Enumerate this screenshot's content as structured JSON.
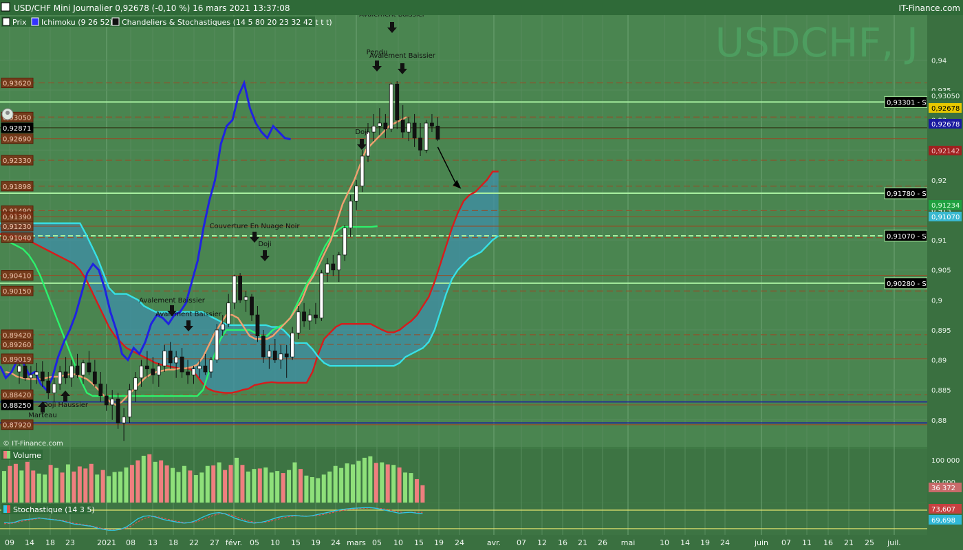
{
  "header": {
    "title": "USD/CHF Mini Journalier 0,92678 (-0,10 %) 16 mars 2021 13:37:08",
    "brand": "IT-Finance.com"
  },
  "legend": [
    {
      "label": "Prix",
      "color": "#ffffff"
    },
    {
      "label": "Ichimoku (9 26 52)",
      "color": "#3333ff"
    },
    {
      "label": "Chandeliers & Stochastiques (14 5 80 20 23 32 42 t t t)",
      "color": "#111111"
    }
  ],
  "watermark": "USDCHF, J",
  "copyright": "© IT-Finance.com",
  "colors": {
    "background": "#3f7a45",
    "grid": "#5d9163",
    "chikou": "#1f23e0",
    "tenkan": "#f0a070",
    "kijun": "#2cf26c",
    "spanA": "#d81b1b",
    "spanB": "#37e0e6",
    "cloud": "#3f8fa8",
    "support": "#a8f0a0",
    "resistance_dash": "#a0401a",
    "hline_solid": "#9a4a24",
    "blue_line": "#1a1aa0",
    "vol_up": "#8ee07a",
    "vol_down": "#ef7f7f",
    "stoch_k": "#30c8e8",
    "stoch_d": "#e05050",
    "stoch_band": "#e8e870"
  },
  "chart_data": [
    {
      "type": "line",
      "name": "price",
      "ylim": [
        0.8755,
        0.9475
      ],
      "y_ticks": [
        0.88,
        0.885,
        0.89,
        0.895,
        0.9,
        0.905,
        0.91,
        0.915,
        0.92,
        0.925,
        0.93,
        0.935,
        0.94
      ],
      "y_tick_labels": [
        "0,88",
        "0,885",
        "0,89",
        "0,895",
        "0,9",
        "0,905",
        "0,91",
        "0,915",
        "0,92",
        "0,925",
        "0,93",
        "0,935",
        "0,94"
      ],
      "x_labels": [
        "09",
        "14",
        "18",
        "23",
        "2021",
        "08",
        "13",
        "18",
        "22",
        "27",
        "févr.",
        "05",
        "10",
        "15",
        "19",
        "24",
        "mars",
        "05",
        "10",
        "15",
        "19",
        "24",
        "avr.",
        "07",
        "12",
        "16",
        "21",
        "26",
        "mai",
        "10",
        "14",
        "19",
        "24",
        "juin",
        "07",
        "11",
        "16",
        "21",
        "25",
        "juil."
      ],
      "left_levels": [
        {
          "label": "0,93620",
          "value": 0.9362
        },
        {
          "label": "0,93050",
          "value": 0.9305
        },
        {
          "label": "0,92871",
          "value": 0.92871
        },
        {
          "label": "0,92690",
          "value": 0.9269
        },
        {
          "label": "0,92330",
          "value": 0.9233
        },
        {
          "label": "0,91898",
          "value": 0.91898
        },
        {
          "label": "0,91490",
          "value": 0.9149
        },
        {
          "label": "0,91390",
          "value": 0.9139
        },
        {
          "label": "0,91230",
          "value": 0.9123
        },
        {
          "label": "0,91040",
          "value": 0.9104
        },
        {
          "label": "0,90410",
          "value": 0.9041
        },
        {
          "label": "0,90150",
          "value": 0.9015
        },
        {
          "label": "0,89420",
          "value": 0.8942
        },
        {
          "label": "0,89260",
          "value": 0.8926
        },
        {
          "label": "0,89019",
          "value": 0.89019
        },
        {
          "label": "0,88420",
          "value": 0.8842
        },
        {
          "label": "0,88250",
          "value": 0.8825
        },
        {
          "label": "0,87920",
          "value": 0.8792
        }
      ],
      "supports": [
        {
          "label": "0,93301 - S",
          "value": 0.93301
        },
        {
          "label": "0,91780 - S",
          "value": 0.9178
        },
        {
          "label": "0,91070 - S",
          "value": 0.9107
        },
        {
          "label": "0,90280 - S",
          "value": 0.9028
        }
      ],
      "right_badges": [
        {
          "label": "0,93050",
          "value": 0.9305
        },
        {
          "label": "0,92678",
          "value": 0.92678
        },
        {
          "label": "0,92678",
          "value": 0.92678
        },
        {
          "label": "0,92142",
          "value": 0.92142
        },
        {
          "label": "0,91234",
          "value": 0.91234
        },
        {
          "label": "0,91070",
          "value": 0.9107
        }
      ],
      "patterns": [
        {
          "label": "Avalement Baissier",
          "date": "06 mars"
        },
        {
          "label": "Pendu",
          "date": "05 mars"
        },
        {
          "label": "Avalement Baissier",
          "date": "09 mars"
        },
        {
          "label": "Doji",
          "date": "01 mars"
        },
        {
          "label": "Couverture En Nuage Noir",
          "date": "02 févr."
        },
        {
          "label": "Doji",
          "date": "03 févr."
        },
        {
          "label": "Avalement Baissier",
          "date": "18 janv."
        },
        {
          "label": "Avalement Baissier",
          "date": "21 janv."
        },
        {
          "label": "Doji Haussier",
          "date": "17 déc."
        },
        {
          "label": "Marteau",
          "date": "15 déc."
        }
      ],
      "candles": [
        [
          0.888,
          0.89,
          0.886,
          0.889
        ],
        [
          0.889,
          0.8905,
          0.8865,
          0.887
        ],
        [
          0.887,
          0.889,
          0.885,
          0.8875
        ],
        [
          0.8875,
          0.8895,
          0.886,
          0.888
        ],
        [
          0.888,
          0.8898,
          0.8855,
          0.8865
        ],
        [
          0.8865,
          0.888,
          0.8835,
          0.8845
        ],
        [
          0.8845,
          0.887,
          0.883,
          0.886
        ],
        [
          0.886,
          0.889,
          0.885,
          0.888
        ],
        [
          0.888,
          0.8905,
          0.886,
          0.887
        ],
        [
          0.887,
          0.89,
          0.8855,
          0.889
        ],
        [
          0.889,
          0.891,
          0.887,
          0.8875
        ],
        [
          0.8875,
          0.89,
          0.886,
          0.8895
        ],
        [
          0.8895,
          0.8915,
          0.8875,
          0.888
        ],
        [
          0.888,
          0.89,
          0.8855,
          0.886
        ],
        [
          0.886,
          0.888,
          0.883,
          0.884
        ],
        [
          0.884,
          0.886,
          0.8815,
          0.8825
        ],
        [
          0.8825,
          0.885,
          0.88,
          0.8835
        ],
        [
          0.8835,
          0.8845,
          0.8785,
          0.8795
        ],
        [
          0.8795,
          0.882,
          0.8765,
          0.8805
        ],
        [
          0.8805,
          0.886,
          0.8795,
          0.885
        ],
        [
          0.885,
          0.888,
          0.883,
          0.887
        ],
        [
          0.887,
          0.89,
          0.8855,
          0.889
        ],
        [
          0.889,
          0.8915,
          0.887,
          0.8885
        ],
        [
          0.8885,
          0.8905,
          0.886,
          0.8875
        ],
        [
          0.8875,
          0.8895,
          0.8855,
          0.889
        ],
        [
          0.889,
          0.8925,
          0.888,
          0.8915
        ],
        [
          0.8915,
          0.893,
          0.8885,
          0.8895
        ],
        [
          0.8895,
          0.8915,
          0.887,
          0.8905
        ],
        [
          0.8905,
          0.892,
          0.887,
          0.888
        ],
        [
          0.888,
          0.89,
          0.886,
          0.8875
        ],
        [
          0.8875,
          0.889,
          0.886,
          0.8885
        ],
        [
          0.8885,
          0.89,
          0.887,
          0.889
        ],
        [
          0.889,
          0.891,
          0.8875,
          0.888
        ],
        [
          0.888,
          0.8905,
          0.887,
          0.89
        ],
        [
          0.89,
          0.896,
          0.8895,
          0.895
        ],
        [
          0.895,
          0.8975,
          0.894,
          0.896
        ],
        [
          0.896,
          0.901,
          0.8955,
          0.8995
        ],
        [
          0.8995,
          0.9042,
          0.8985,
          0.904
        ],
        [
          0.904,
          0.9045,
          0.8995,
          0.9
        ],
        [
          0.9,
          0.9015,
          0.898,
          0.9005
        ],
        [
          0.9005,
          0.901,
          0.8965,
          0.8975
        ],
        [
          0.8975,
          0.899,
          0.893,
          0.894
        ],
        [
          0.894,
          0.895,
          0.8895,
          0.8905
        ],
        [
          0.8905,
          0.8925,
          0.8885,
          0.8915
        ],
        [
          0.8915,
          0.8935,
          0.8895,
          0.89
        ],
        [
          0.89,
          0.8925,
          0.8885,
          0.891
        ],
        [
          0.891,
          0.8925,
          0.887,
          0.8905
        ],
        [
          0.8905,
          0.8955,
          0.89,
          0.8945
        ],
        [
          0.8945,
          0.899,
          0.8935,
          0.898
        ],
        [
          0.898,
          0.8995,
          0.8955,
          0.8965
        ],
        [
          0.8965,
          0.8985,
          0.895,
          0.8975
        ],
        [
          0.8975,
          0.8995,
          0.896,
          0.897
        ],
        [
          0.897,
          0.905,
          0.8965,
          0.9045
        ],
        [
          0.9045,
          0.907,
          0.903,
          0.906
        ],
        [
          0.906,
          0.9075,
          0.904,
          0.905
        ],
        [
          0.905,
          0.908,
          0.903,
          0.9075
        ],
        [
          0.9075,
          0.9125,
          0.9065,
          0.912
        ],
        [
          0.912,
          0.9175,
          0.9105,
          0.9165
        ],
        [
          0.9165,
          0.92,
          0.915,
          0.919
        ],
        [
          0.919,
          0.925,
          0.918,
          0.924
        ],
        [
          0.924,
          0.9295,
          0.923,
          0.928
        ],
        [
          0.928,
          0.931,
          0.9265,
          0.929
        ],
        [
          0.929,
          0.932,
          0.9275,
          0.9295
        ],
        [
          0.9295,
          0.931,
          0.927,
          0.9285
        ],
        [
          0.9285,
          0.9362,
          0.928,
          0.936
        ],
        [
          0.936,
          0.9365,
          0.9285,
          0.93
        ],
        [
          0.93,
          0.9325,
          0.927,
          0.928
        ],
        [
          0.928,
          0.9305,
          0.9265,
          0.9295
        ],
        [
          0.9295,
          0.931,
          0.9255,
          0.927
        ],
        [
          0.927,
          0.9295,
          0.924,
          0.925
        ],
        [
          0.925,
          0.93,
          0.9245,
          0.9295
        ],
        [
          0.9295,
          0.931,
          0.928,
          0.929
        ],
        [
          0.929,
          0.9305,
          0.9265,
          0.9268
        ]
      ],
      "projection": {
        "from_value": 0.9255,
        "to_value": 0.919
      }
    },
    {
      "type": "bar",
      "name": "Volume",
      "y_tick_labels": [
        "100 000",
        "50 000"
      ],
      "last_value_label": "36 372",
      "values": [
        62,
        72,
        76,
        63,
        80,
        63,
        57,
        55,
        74,
        68,
        59,
        75,
        61,
        71,
        67,
        76,
        55,
        64,
        52,
        60,
        61,
        69,
        74,
        83,
        92,
        95,
        80,
        83,
        73,
        68,
        60,
        72,
        63,
        54,
        59,
        72,
        73,
        79,
        64,
        74,
        88,
        74,
        61,
        66,
        67,
        69,
        59,
        62,
        58,
        64,
        79,
        66,
        53,
        50,
        48,
        55,
        61,
        72,
        68,
        77,
        75,
        82,
        88,
        91,
        78,
        79,
        75,
        74,
        69,
        59,
        58,
        46,
        34
      ],
      "up": [
        1,
        0,
        0,
        1,
        0,
        0,
        1,
        1,
        0,
        1,
        0,
        1,
        0,
        0,
        0,
        0,
        1,
        0,
        1,
        1,
        1,
        1,
        0,
        0,
        1,
        0,
        1,
        0,
        0,
        1,
        1,
        1,
        0,
        1,
        1,
        1,
        0,
        1,
        0,
        0,
        1,
        0,
        1,
        1,
        0,
        1,
        1,
        1,
        0,
        1,
        1,
        0,
        1,
        1,
        1,
        1,
        1,
        1,
        1,
        1,
        1,
        1,
        1,
        1,
        0,
        1,
        0,
        1,
        0,
        1,
        1,
        0,
        0
      ]
    },
    {
      "type": "line",
      "name": "Stochastique (14 3 5)",
      "ylim": [
        0,
        100
      ],
      "bands": [
        20,
        80
      ],
      "right_labels": [
        "73,607",
        "69,698"
      ],
      "k_values": [
        40,
        38,
        42,
        48,
        50,
        52,
        55,
        52,
        50,
        48,
        45,
        40,
        35,
        33,
        30,
        28,
        22,
        18,
        15,
        15,
        18,
        25,
        38,
        52,
        60,
        62,
        58,
        52,
        47,
        44,
        40,
        38,
        40,
        46,
        56,
        64,
        70,
        72,
        68,
        60,
        52,
        46,
        41,
        38,
        40,
        44,
        50,
        56,
        60,
        62,
        63,
        61,
        60,
        62,
        66,
        70,
        74,
        78,
        82,
        84,
        86,
        87,
        88,
        88,
        86,
        82,
        78,
        74,
        70,
        72,
        73,
        70,
        69
      ],
      "d_values": [
        36,
        37,
        39,
        44,
        47,
        50,
        53,
        53,
        51,
        49,
        47,
        43,
        38,
        35,
        32,
        29,
        25,
        20,
        17,
        16,
        17,
        21,
        30,
        42,
        52,
        58,
        60,
        56,
        51,
        47,
        43,
        40,
        39,
        42,
        48,
        56,
        63,
        68,
        69,
        65,
        58,
        51,
        45,
        41,
        40,
        41,
        45,
        50,
        55,
        59,
        61,
        62,
        61,
        61,
        63,
        66,
        70,
        74,
        78,
        81,
        83,
        85,
        86,
        87,
        87,
        85,
        82,
        78,
        74,
        72,
        73,
        73,
        73
      ]
    }
  ]
}
